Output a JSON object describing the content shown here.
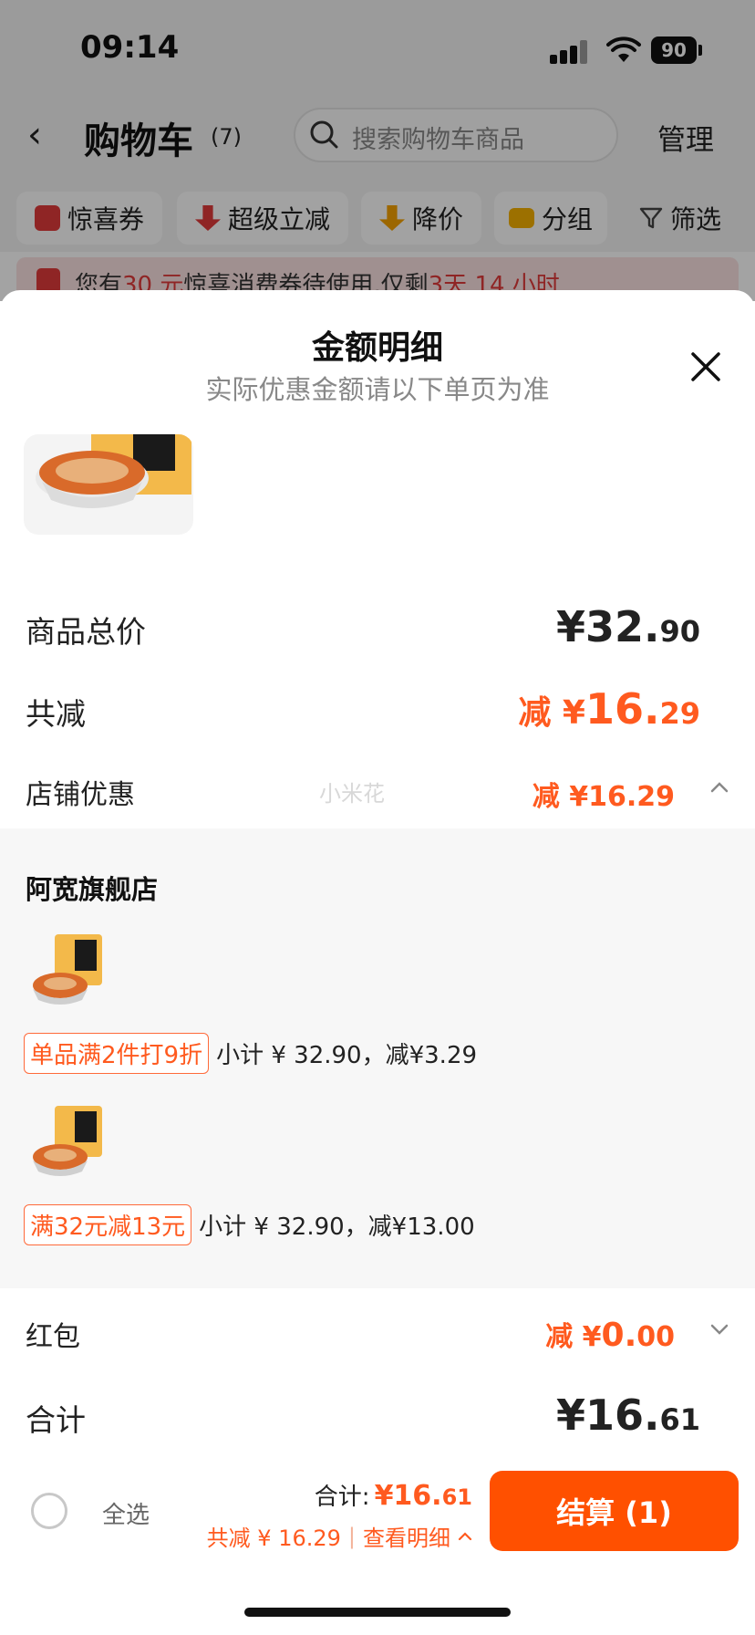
{
  "status_bar": {
    "time": "09:14",
    "battery": "90"
  },
  "header": {
    "title": "购物车",
    "count": "(7)",
    "search_placeholder": "搜索购物车商品",
    "manage": "管理"
  },
  "filters": [
    {
      "label": "惊喜券",
      "icon": "coupon-icon",
      "color": "#e03a3a"
    },
    {
      "label": "超级立减",
      "icon": "arrow-down-red-icon",
      "color": "#e03a3a"
    },
    {
      "label": "降价",
      "icon": "arrow-down-yellow-icon",
      "color": "#f5a200"
    },
    {
      "label": "分组",
      "icon": "folder-icon",
      "color": "#f5b000"
    },
    {
      "label": "筛选",
      "icon": "filter-icon",
      "color": "#444444"
    }
  ],
  "banner": {
    "pre": "您有",
    "amount": "30 元",
    "mid": "惊喜消费券待使用,仅剩",
    "time": "3天 14 小时"
  },
  "sheet": {
    "title": "金额明细",
    "subtitle": "实际优惠金额请以下单页为准",
    "total_label": "商品总价",
    "total_int": "¥32.",
    "total_dec": "90",
    "discount_label": "共减",
    "discount_pre": "减 ¥",
    "discount_int": "16.",
    "discount_dec": "29",
    "shop_discount_label": "店铺优惠",
    "shop_discount_value": "减 ¥16.29",
    "watermark": "小米花",
    "store_name": "阿宽旗舰店",
    "promos": [
      {
        "tag": "单品满2件打9折",
        "note": "小计 ¥ 32.90，减¥3.29"
      },
      {
        "tag": "满32元减13元",
        "note": "小计 ¥ 32.90，减¥13.00"
      }
    ],
    "redpacket_label": "红包",
    "redpacket_pre": "减 ¥",
    "redpacket_int": "0.",
    "redpacket_dec": "00",
    "sum_label": "合计",
    "sum_int": "¥16.",
    "sum_dec": "61"
  },
  "bottom_bar": {
    "select_all": "全选",
    "total_label": "合计:",
    "total_int": "¥16.",
    "total_dec": "61",
    "saved": "共减 ¥ 16.29",
    "details": "查看明细",
    "checkout": "结算 (1)"
  },
  "colors": {
    "accent": "#ff5000",
    "discount": "#ff5a1f"
  }
}
